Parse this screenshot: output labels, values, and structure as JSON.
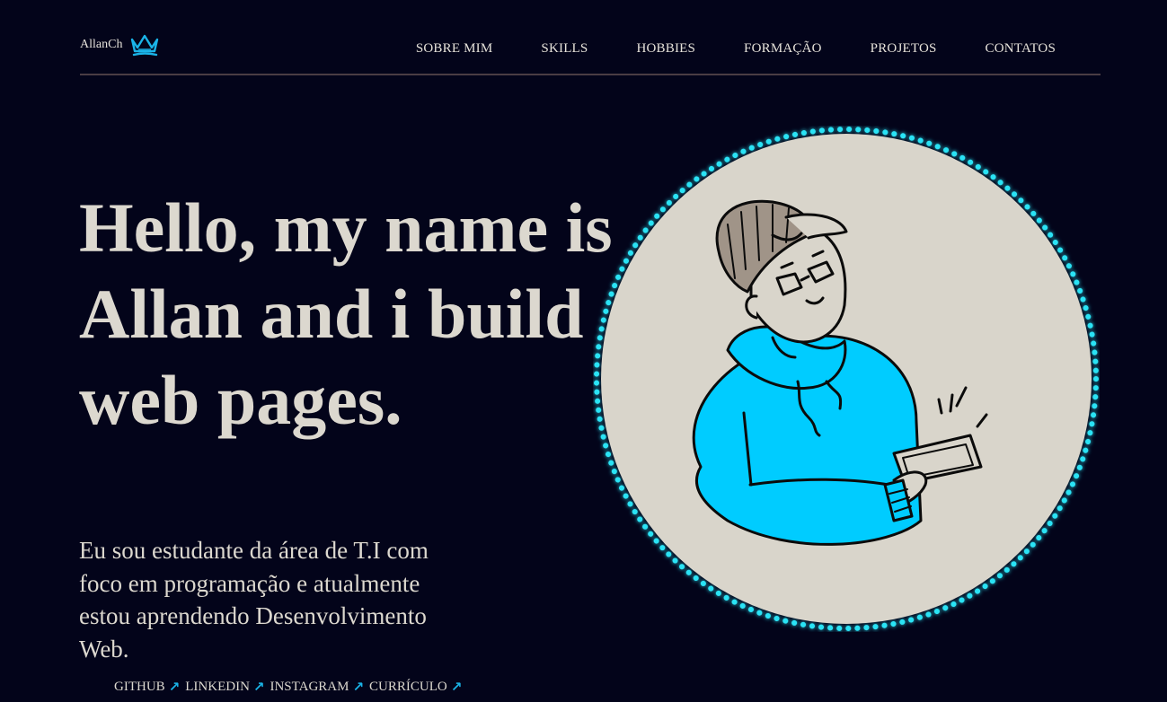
{
  "header": {
    "brand": "AllanCh",
    "brand_icon": "crown-icon",
    "nav": [
      {
        "label": "SOBRE MIM"
      },
      {
        "label": "SKILLS"
      },
      {
        "label": "HOBBIES"
      },
      {
        "label": "FORMAÇÃO"
      },
      {
        "label": "PROJETOS"
      },
      {
        "label": "CONTATOS"
      }
    ]
  },
  "hero": {
    "title": "Hello, my name is Allan and i build web pages.",
    "description": "Eu sou estudante da área de T.I com foco em programação e atualmente estou aprendendo Desenvolvimento Web.",
    "links": [
      {
        "label": "GITHUB",
        "icon": "arrow-up-right-icon"
      },
      {
        "label": "LINKEDIN",
        "icon": "arrow-up-right-icon"
      },
      {
        "label": "INSTAGRAM",
        "icon": "arrow-up-right-icon"
      },
      {
        "label": "CURRÍCULO",
        "icon": "arrow-up-right-icon"
      }
    ]
  },
  "colors": {
    "background": "#03041a",
    "text": "#dcd8cf",
    "accent": "#1ab4e8",
    "hoodie": "#00ccff",
    "circle_fill": "#d9d5cb",
    "glow_dots": "#29e3f5"
  }
}
